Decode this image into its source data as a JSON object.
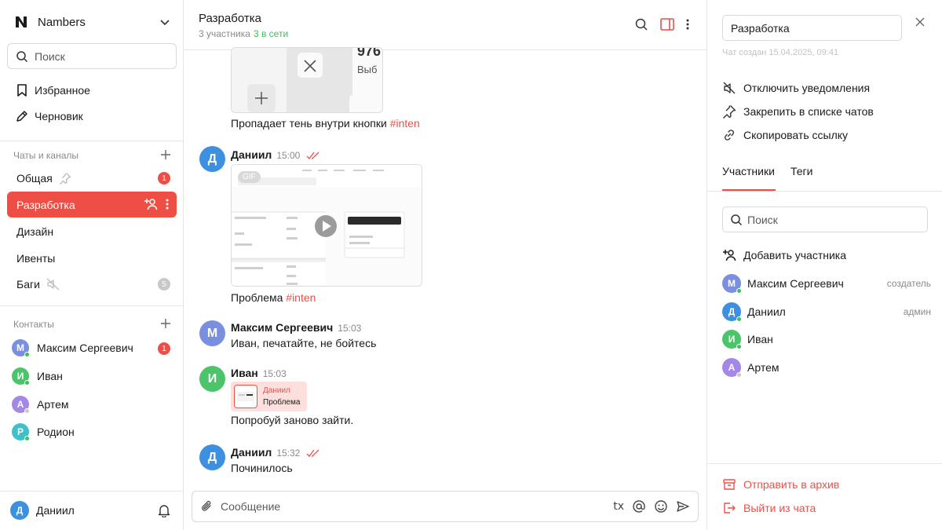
{
  "sidebar": {
    "workspace_name": "Nambers",
    "search_placeholder": "Поиск",
    "favorites_label": "Избранное",
    "drafts_label": "Черновик",
    "chats_section_title": "Чаты и каналы",
    "chats": [
      {
        "name": "Общая",
        "badge": "1",
        "pinned": true
      },
      {
        "name": "Разработка",
        "active": true
      },
      {
        "name": "Дизайн"
      },
      {
        "name": "Ивенты"
      },
      {
        "name": "Баги",
        "muted": true,
        "badge": "5"
      }
    ],
    "contacts_section_title": "Контакты",
    "contacts": [
      {
        "name": "Максим Сергеевич",
        "initial": "М",
        "badge": "1",
        "online": true,
        "color": "#7b8fe0"
      },
      {
        "name": "Иван",
        "initial": "И",
        "online": true,
        "color": "#4cc46a"
      },
      {
        "name": "Артем",
        "initial": "А",
        "online": false,
        "color": "#a487e6"
      },
      {
        "name": "Родион",
        "initial": "Р",
        "online": true,
        "color": "#3fc1c9"
      }
    ],
    "current_user": {
      "name": "Даниил",
      "initial": "Д",
      "color": "#3d8fe0"
    }
  },
  "chat": {
    "title": "Разработка",
    "members_text": "3 участника",
    "online_text": "3 в сети",
    "messages": [
      {
        "text": "Пропадает тень внутри кнопки",
        "tag": "#inten"
      },
      {
        "author": "Даниил",
        "initial": "Д",
        "time": "15:00",
        "text": "Проблема",
        "tag": "#inten",
        "gif_label": "GIF",
        "read": true
      },
      {
        "author": "Максим Сергеевич",
        "initial": "М",
        "time": "15:03",
        "text": "Иван, печатайте, не бойтесь"
      },
      {
        "author": "Иван",
        "initial": "И",
        "time": "15:03",
        "reply_author": "Даниил",
        "reply_text": "Проблема",
        "text": "Попробуй заново зайти."
      },
      {
        "author": "Даниил",
        "initial": "Д",
        "time": "15:32",
        "text": "Починилось",
        "read": true
      }
    ],
    "composer_placeholder": "Сообщение",
    "format_label": "tx"
  },
  "panel": {
    "chat_name_value": "Разработка",
    "created_text": "Чат создан 15.04.2025, 09:41",
    "actions": {
      "mute": "Отключить уведомления",
      "pin": "Закрепить в списке чатов",
      "copy_link": "Скопировать ссылку"
    },
    "tabs": [
      "Участники",
      "Теги"
    ],
    "search_placeholder": "Поиск",
    "add_member_label": "Добавить участника",
    "members": [
      {
        "name": "Максим Сергеевич",
        "initial": "М",
        "role": "создатель",
        "online": true,
        "color": "#7b8fe0"
      },
      {
        "name": "Даниил",
        "initial": "Д",
        "role": "админ",
        "online": true,
        "color": "#3d8fe0"
      },
      {
        "name": "Иван",
        "initial": "И",
        "role": "",
        "online": true,
        "color": "#4cc46a"
      },
      {
        "name": "Артем",
        "initial": "А",
        "role": "",
        "online": false,
        "color": "#a487e6"
      }
    ],
    "archive_label": "Отправить в архив",
    "leave_label": "Выйти из чата"
  },
  "colors": {
    "accent": "#ef4e45",
    "online": "#3cc15c",
    "muted_text": "#8a8a8a"
  }
}
